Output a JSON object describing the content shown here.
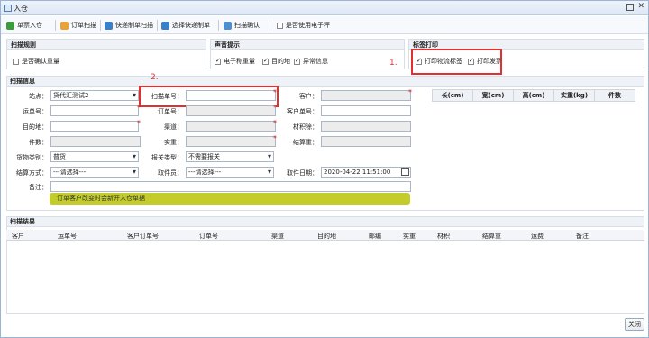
{
  "window": {
    "title": "入仓"
  },
  "toolbar": {
    "new_label": "单票入仓",
    "order_scan_label": "订单扫描",
    "express_scan_label": "快递制单扫描",
    "select_express_label": "选择快递制单",
    "scan_confirm_label": "扫描确认",
    "use_e_scale_label": "是否使用电子秤"
  },
  "scan_rules": {
    "title": "扫描规则",
    "confirm_weight_label": "是否确认重量",
    "confirm_weight_checked": false
  },
  "voice": {
    "title": "声音提示",
    "items": [
      {
        "label": "电子称重量",
        "checked": true
      },
      {
        "label": "目的地",
        "checked": true
      },
      {
        "label": "异常信息",
        "checked": true
      }
    ]
  },
  "label_print": {
    "title": "标签打印",
    "items": [
      {
        "label": "打印物流标签",
        "checked": true
      },
      {
        "label": "打印发票",
        "checked": true
      }
    ]
  },
  "scan_info": {
    "title": "扫描信息",
    "site_label": "站点：",
    "site_value": "货代汇测试2",
    "scan_no_label": "扫描单号：",
    "scan_no_value": "",
    "customer_label": "客户：",
    "customer_value": "",
    "waybill_label": "运单号：",
    "waybill_value": "",
    "order_label": "订单号：",
    "order_value": "",
    "cust_order_label": "客户单号：",
    "cust_order_value": "",
    "dest_label": "目的地：",
    "dest_value": "",
    "channel_label": "渠道：",
    "channel_value": "",
    "volume_label": "材积除：",
    "volume_value": "",
    "pieces_label": "件数：",
    "pieces_value": "",
    "actual_weight_label": "实重：",
    "actual_weight_value": "",
    "settle_weight_label": "结算重：",
    "settle_weight_value": "",
    "cargo_type_label": "货物类别：",
    "cargo_type_value": "普货",
    "customs_type_label": "报关类型：",
    "customs_type_value": "不需要报关",
    "settle_method_label": "结算方式：",
    "settle_method_value": "---请选择---",
    "pickup_label": "取件员：",
    "pickup_value": "---请选择---",
    "pickup_date_label": "取件日期：",
    "pickup_date_value": "2020-04-22 11:51:00",
    "remark_label": "备注：",
    "remark_value": "",
    "banner": "订单客户改变时会新开入仓单据"
  },
  "dimensions": {
    "headers": [
      "长(cm)",
      "宽(cm)",
      "高(cm)",
      "实重(kg)",
      "件数"
    ]
  },
  "results": {
    "title": "扫描结果",
    "headers": [
      "客户",
      "运单号",
      "客户订单号",
      "订单号",
      "渠道",
      "目的地",
      "邮编",
      "实重",
      "材积",
      "结算重",
      "运费",
      "备注"
    ]
  },
  "annotations": {
    "one": "1.",
    "two": "2."
  },
  "footer": {
    "close_label": "关闭"
  },
  "colors": {
    "highlight_red": "#e03030",
    "banner_yellow": "#c3cc2a"
  }
}
